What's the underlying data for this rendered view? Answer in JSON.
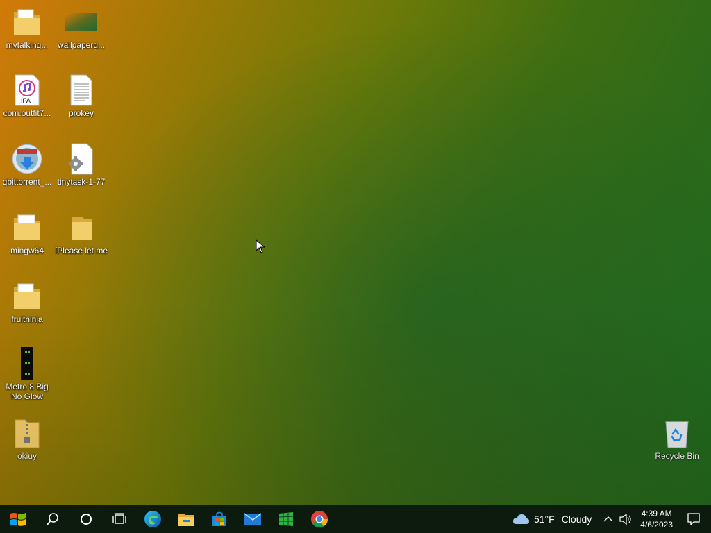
{
  "desktop": {
    "icons": [
      {
        "label": "mytalking..."
      },
      {
        "label": "wallpaperg..."
      },
      {
        "label": "com.outfit7...",
        "badge": "IPA"
      },
      {
        "label": "prokey"
      },
      {
        "label": "qbittorrent_..."
      },
      {
        "label": "tinytask-1-77"
      },
      {
        "label": "mingw64"
      },
      {
        "label": "[Please let me"
      },
      {
        "label": "fruitninja"
      },
      {
        "label": "Metro 8 Big No Glow"
      },
      {
        "label": "okiuy"
      },
      {
        "label": "Recycle Bin"
      }
    ]
  },
  "taskbar": {
    "apps": [
      "start-icon",
      "search-icon",
      "cortana-icon",
      "task-view-icon",
      "edge-icon",
      "file-explorer-icon",
      "store-icon",
      "mail-icon",
      "app-icon",
      "chrome-icon"
    ],
    "weather": {
      "temperature": "51°F",
      "condition": "Cloudy"
    },
    "clock": {
      "time": "4:39 AM",
      "date": "4/6/2023"
    }
  },
  "colors": {
    "taskbar": "#0d1b0f",
    "folder": "#f3cf6b",
    "accent": "#1e90ff"
  }
}
